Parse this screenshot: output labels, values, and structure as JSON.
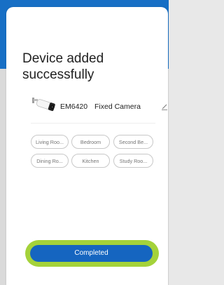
{
  "colors": {
    "header_blue": "#1976d2",
    "button_blue": "#1565c0",
    "highlight_green": "#a4d23a"
  },
  "dialog": {
    "title": "Device added successfully",
    "device": {
      "model": "EM6420",
      "type": "Fixed Camera",
      "icon": "camera-icon"
    },
    "rooms": [
      "Living Roo...",
      "Bedroom",
      "Second Be...",
      "Dining Ro...",
      "Kitchen",
      "Study Roo..."
    ],
    "complete_label": "Completed"
  }
}
